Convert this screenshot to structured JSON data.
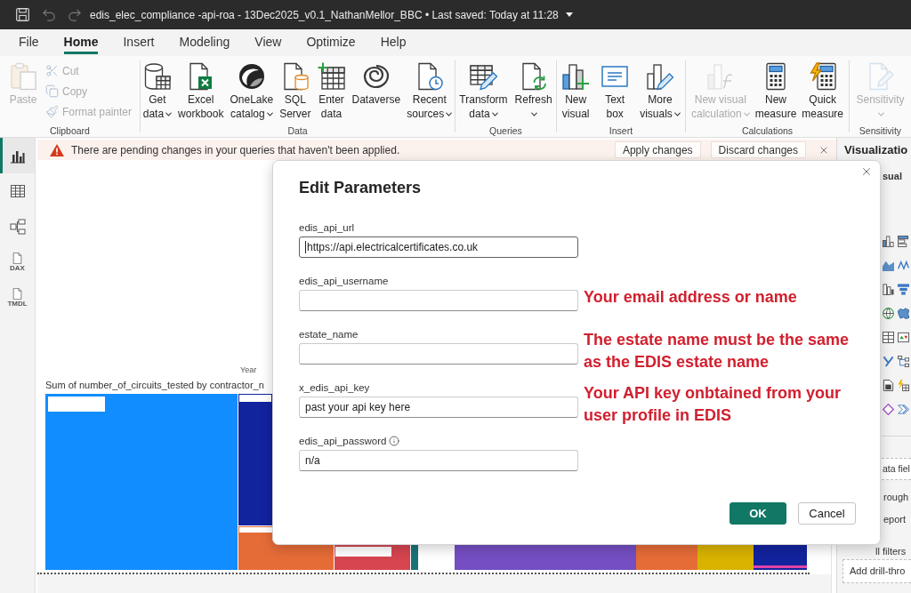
{
  "title_bar": {
    "title": "edis_elec_compliance -api-roa - 13Dec2025_v0.1_NathanMellor_BBC • Last saved: Today at 11:28"
  },
  "menu_tabs": [
    {
      "label": "File",
      "selected": false
    },
    {
      "label": "Home",
      "selected": true
    },
    {
      "label": "Insert",
      "selected": false
    },
    {
      "label": "Modeling",
      "selected": false
    },
    {
      "label": "View",
      "selected": false
    },
    {
      "label": "Optimize",
      "selected": false
    },
    {
      "label": "Help",
      "selected": false
    }
  ],
  "ribbon": [
    {
      "label": "Clipboard",
      "commands": [
        {
          "kind": "large",
          "lines": [
            "Paste"
          ],
          "dropdown": false,
          "disabled": true
        },
        {
          "kind": "small",
          "lines": [
            "Cut"
          ],
          "dropdown": false,
          "disabled": true
        },
        {
          "kind": "small",
          "lines": [
            "Copy"
          ],
          "dropdown": false,
          "disabled": true
        },
        {
          "kind": "small",
          "lines": [
            "Format painter"
          ],
          "dropdown": false,
          "disabled": true
        }
      ]
    },
    {
      "label": "Data",
      "commands": [
        {
          "kind": "large",
          "lines": [
            "Get",
            "data"
          ],
          "dropdown": true,
          "disabled": false
        },
        {
          "kind": "large",
          "lines": [
            "Excel",
            "workbook"
          ],
          "dropdown": false,
          "disabled": false
        },
        {
          "kind": "large",
          "lines": [
            "OneLake",
            "catalog"
          ],
          "dropdown": true,
          "disabled": false
        },
        {
          "kind": "large",
          "lines": [
            "SQL",
            "Server"
          ],
          "dropdown": false,
          "disabled": false
        },
        {
          "kind": "large",
          "lines": [
            "Enter",
            "data"
          ],
          "dropdown": false,
          "disabled": false
        },
        {
          "kind": "large",
          "lines": [
            "Dataverse"
          ],
          "dropdown": false,
          "disabled": false
        },
        {
          "kind": "large",
          "lines": [
            "Recent",
            "sources"
          ],
          "dropdown": true,
          "disabled": false
        }
      ]
    },
    {
      "label": "Queries",
      "commands": [
        {
          "kind": "large",
          "lines": [
            "Transform",
            "data"
          ],
          "dropdown": true,
          "disabled": false
        },
        {
          "kind": "large",
          "lines": [
            "Refresh"
          ],
          "dropdown": true,
          "disabled": false
        }
      ]
    },
    {
      "label": "Insert",
      "commands": [
        {
          "kind": "large",
          "lines": [
            "New",
            "visual"
          ],
          "dropdown": false,
          "disabled": false
        },
        {
          "kind": "large",
          "lines": [
            "Text",
            "box"
          ],
          "dropdown": false,
          "disabled": false
        },
        {
          "kind": "large",
          "lines": [
            "More",
            "visuals"
          ],
          "dropdown": true,
          "disabled": false
        }
      ]
    },
    {
      "label": "Calculations",
      "commands": [
        {
          "kind": "large",
          "lines": [
            "New visual",
            "calculation"
          ],
          "dropdown": true,
          "disabled": true
        },
        {
          "kind": "large",
          "lines": [
            "New",
            "measure"
          ],
          "dropdown": false,
          "disabled": false
        },
        {
          "kind": "large",
          "lines": [
            "Quick",
            "measure"
          ],
          "dropdown": false,
          "disabled": false
        }
      ]
    },
    {
      "label": "Sensitivity",
      "commands": [
        {
          "kind": "large",
          "lines": [
            "Sensitivity"
          ],
          "dropdown": true,
          "disabled": true
        }
      ]
    }
  ],
  "rail": [
    {
      "selected": true
    },
    {
      "selected": false
    },
    {
      "selected": false
    },
    {
      "label": "DAX",
      "selected": false
    },
    {
      "label": "TMDL",
      "selected": false
    }
  ],
  "notification": {
    "message": "There are pending changes in your queries that haven't been applied.",
    "buttons": [
      "Apply changes",
      "Discard changes"
    ]
  },
  "canvas": {
    "visual": {
      "axis_label": "Year",
      "title": "Sum of number_of_circuits_tested by contractor_n"
    }
  },
  "panel": {
    "title": "Visualizatio",
    "tab": "sual",
    "field_well": "ata fiel",
    "options": [
      "rough",
      "eport",
      "ll filters"
    ],
    "drill_through": "Add drill-thro"
  },
  "dialog": {
    "title": "Edit Parameters",
    "fields": [
      {
        "label": "edis_api_url",
        "value": "https://api.electricalcertificates.co.uk",
        "focused": true,
        "info": false
      },
      {
        "label": "edis_api_username",
        "focused": false,
        "info": false,
        "note": "Your email address or name"
      },
      {
        "label": "estate_name",
        "focused": false,
        "info": false,
        "note": "The estate name must be the same as the EDIS estate name"
      },
      {
        "label": "x_edis_api_key",
        "value": "past your api key here",
        "focused": false,
        "info": false,
        "note": "Your API key onbtained from your user profile in EDIS"
      },
      {
        "label": "edis_api_password",
        "value": "n/a",
        "focused": false,
        "info": true
      }
    ],
    "buttons": [
      {
        "label": "OK",
        "kind": "primary"
      },
      {
        "label": "Cancel",
        "kind": "secondary"
      }
    ]
  }
}
